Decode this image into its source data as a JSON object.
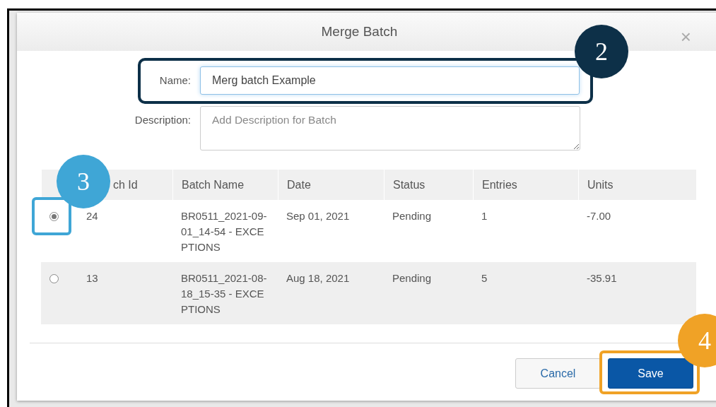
{
  "dialog": {
    "title": "Merge Batch",
    "close": "×"
  },
  "form": {
    "name": {
      "label": "Name:",
      "value": "Merg batch Example"
    },
    "description": {
      "label": "Description:",
      "placeholder": "Add Description for Batch"
    }
  },
  "table": {
    "columns": [
      "ch Id",
      "Batch Name",
      "Date",
      "Status",
      "Entries",
      "Units"
    ],
    "rows": [
      {
        "selected": true,
        "cells": [
          "24",
          "BR0511_2021-09-01_14-54 - EXCEPTIONS",
          "Sep 01, 2021",
          "Pending",
          "1",
          "-7.00"
        ]
      },
      {
        "selected": false,
        "cells": [
          "13",
          "BR0511_2021-08-18_15-35 - EXCEPTIONS",
          "Aug 18, 2021",
          "Pending",
          "5",
          "-35.91"
        ]
      }
    ]
  },
  "buttons": [
    {
      "label": "Cancel",
      "kind": "secondary"
    },
    {
      "label": "Save",
      "kind": "primary"
    }
  ],
  "callouts": [
    {
      "number": "2",
      "color": "#0d3048"
    },
    {
      "number": "3",
      "color": "#3fa6d6"
    },
    {
      "number": "4",
      "color": "#f0a226"
    }
  ]
}
